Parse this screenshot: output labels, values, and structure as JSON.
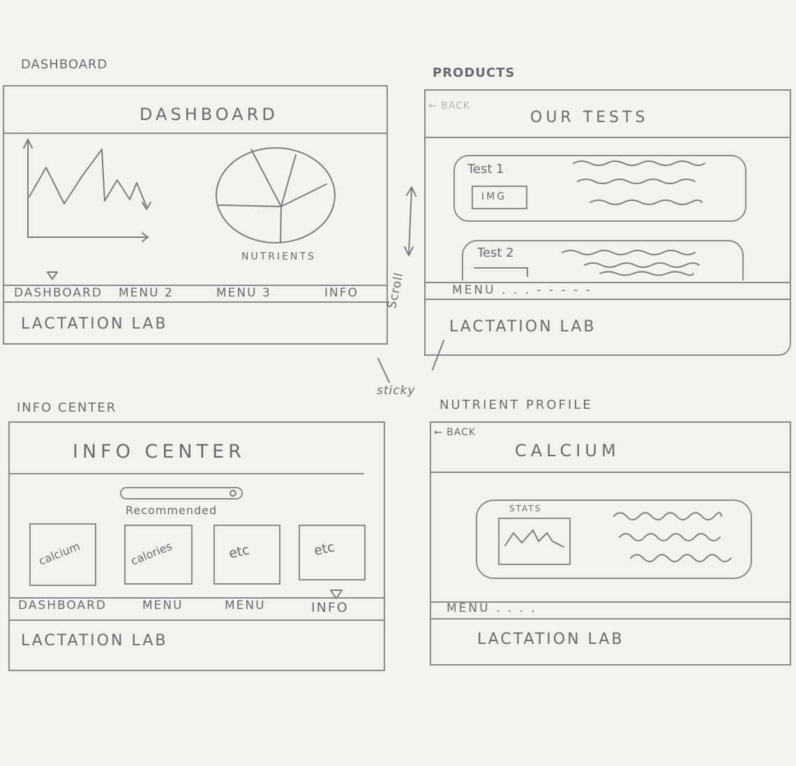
{
  "sketch": {
    "dashboard": {
      "label": "DASHBOARD",
      "title": "DASHBOARD",
      "pie_label": "NUTRIENTS",
      "nav": [
        "DASHBOARD",
        "MENU 2",
        "MENU 3",
        "INFO"
      ],
      "footer": "LACTATION LAB"
    },
    "products": {
      "label": "PRODUCTS",
      "back": "← BACK",
      "title": "OUR TESTS",
      "test1": "Test 1",
      "img": "IMG",
      "test2": "Test 2",
      "nav": "MENU . . . - - - - -",
      "footer": "LACTATION LAB"
    },
    "annotations": {
      "scroll": "Scroll",
      "sticky": "sticky"
    },
    "info_center": {
      "label": "INFO CENTER",
      "title": "INFO CENTER",
      "recommended": "Recommended",
      "tiles": [
        "calcium",
        "calories",
        "etc",
        "etc"
      ],
      "nav": [
        "DASHBOARD",
        "MENU",
        "MENU",
        "INFO"
      ],
      "footer": "LACTATION LAB"
    },
    "nutrient_profile": {
      "label": "NUTRIENT PROFILE",
      "back": "← BACK",
      "title": "CALCIUM",
      "stats": "STATS",
      "nav": "MENU . . . .",
      "footer": "LACTATION LAB"
    }
  },
  "colors": {
    "paper": "#f3f2ef",
    "pencil": "#7d7d7d"
  }
}
